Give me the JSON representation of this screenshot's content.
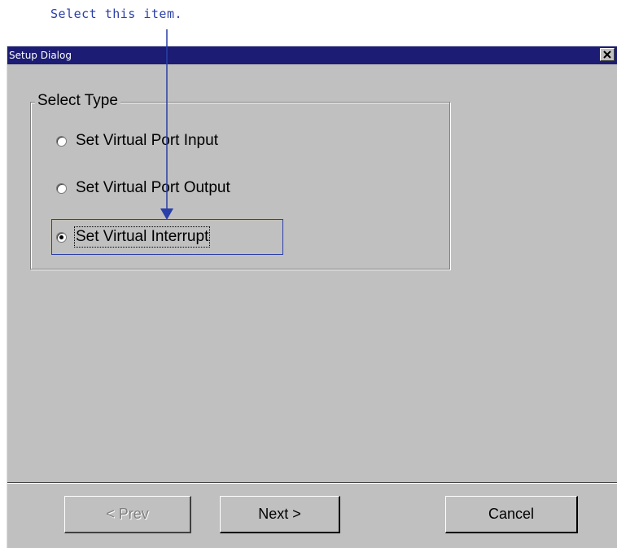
{
  "annotation": {
    "text": "Select this item.",
    "arrow_color": "#2a3fa8"
  },
  "dialog": {
    "title": "Setup Dialog",
    "close_icon": "close-icon",
    "title_bar_color": "#1c1c74",
    "group": {
      "legend": "Select Type",
      "options": [
        {
          "label": "Set Virtual Port Input",
          "checked": false
        },
        {
          "label": "Set Virtual Port Output",
          "checked": false
        },
        {
          "label": "Set Virtual Interrupt",
          "checked": true
        }
      ]
    },
    "buttons": {
      "prev": {
        "label": "< Prev",
        "enabled": false
      },
      "next": {
        "label": "Next >",
        "enabled": true
      },
      "cancel": {
        "label": "Cancel",
        "enabled": true
      }
    }
  }
}
